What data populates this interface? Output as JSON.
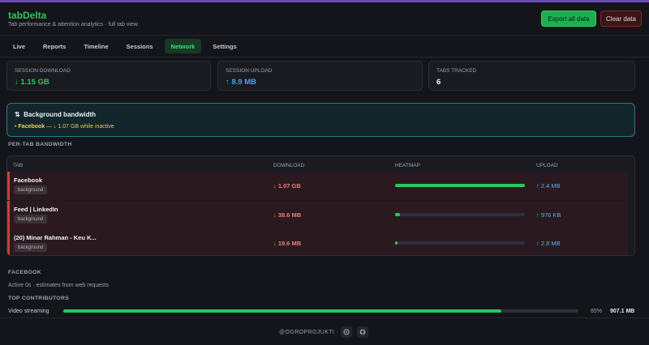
{
  "app": {
    "title": "tabDelta",
    "subtitle": "Tab performance & attention analytics · full tab view",
    "export_label": "Export all data",
    "clear_label": "Clear data"
  },
  "nav": {
    "tabs": [
      "Live",
      "Reports",
      "Timeline",
      "Sessions",
      "Network",
      "Settings"
    ],
    "active": "Network"
  },
  "stats": [
    {
      "label": "SESSION DOWNLOAD",
      "value": "↓ 1.15 GB",
      "color": "#27c85a"
    },
    {
      "label": "SESSION UPLOAD",
      "value": "↑ 8.9 MB",
      "color": "#3fa7f0"
    },
    {
      "label": "TABS TRACKED",
      "value": "6",
      "color": "#f0f2f5"
    }
  ],
  "background_bandwidth": {
    "icon": "⇅",
    "title": "Background bandwidth",
    "items": [
      {
        "site": "Facebook",
        "detail": " — ↓ 1.07 GB while inactive"
      }
    ]
  },
  "per_tab": {
    "heading": "PER-TAB BANDWIDTH",
    "columns": [
      "TAB",
      "DOWNLOAD",
      "HEATMAP",
      "UPLOAD"
    ],
    "rows": [
      {
        "name": "Facebook",
        "badge": "background",
        "download": "↓ 1.07 GB",
        "heat": 1.0,
        "upload": "↑ 2.4 MB"
      },
      {
        "name": "Feed | LinkedIn",
        "badge": "background",
        "download": "↓ 38.6 MB",
        "heat": 0.04,
        "upload": "↑ 976 KB"
      },
      {
        "name": "(20) Minar Rahman - Keu K...",
        "badge": "background",
        "download": "↓ 19.6 MB",
        "heat": 0.02,
        "upload": "↑ 2.8 MB"
      }
    ]
  },
  "detail": {
    "site": "FACEBOOK",
    "note": "Active 0s · estimates from web requests",
    "contributors_heading": "TOP CONTRIBUTORS",
    "contributors": [
      {
        "label": "Video streaming",
        "percent": "85%",
        "fraction": 0.85,
        "size": "907.1 MB"
      }
    ]
  },
  "footer": {
    "text": "@OGROPROJUKTI ·",
    "icons": [
      "app-icon",
      "github-icon"
    ]
  }
}
